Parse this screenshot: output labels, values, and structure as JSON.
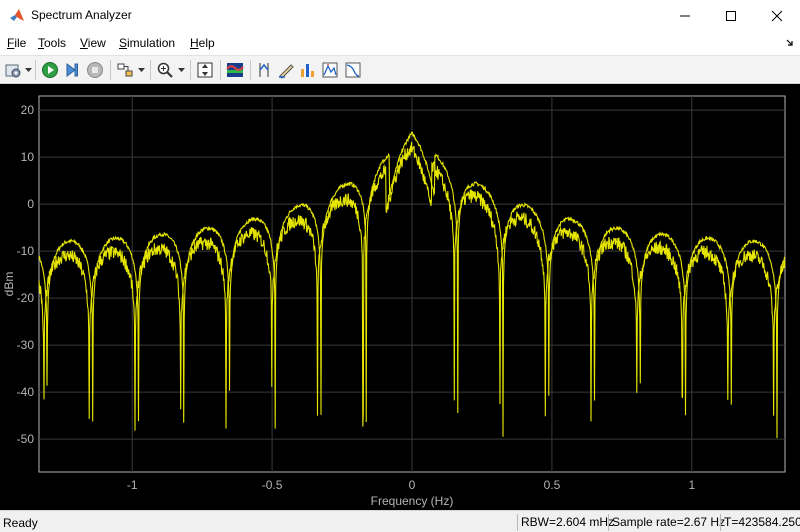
{
  "window": {
    "title": "Spectrum Analyzer",
    "app_icon": "matlab-logo-icon",
    "controls": [
      "minimize-icon",
      "maximize-icon",
      "close-icon"
    ]
  },
  "menu": {
    "items": [
      {
        "label": "File",
        "mnemonic": "F",
        "rest": "ile"
      },
      {
        "label": "Tools",
        "mnemonic": "T",
        "rest": "ools"
      },
      {
        "label": "View",
        "mnemonic": "V",
        "rest": "iew"
      },
      {
        "label": "Simulation",
        "mnemonic": "S",
        "rest": "imulation"
      },
      {
        "label": "Help",
        "mnemonic": "H",
        "rest": "elp"
      }
    ]
  },
  "toolbar": {
    "buttons": [
      "settings-icon",
      "run-icon",
      "step-forward-icon",
      "stop-icon",
      "highlight-block-icon",
      "zoom-in-icon",
      "scale-axes-icon",
      "spectrogram-icon",
      "cursor-measurements-icon",
      "channel-measurements-icon",
      "distortion-measurements-icon",
      "peak-finder-icon",
      "ccdf-measurements-icon"
    ]
  },
  "plot": {
    "background": "#000000",
    "axes_color": "#b4b4b4",
    "trace_color": "#e6e600"
  },
  "chart_data": {
    "type": "line",
    "xlabel": "Frequency (Hz)",
    "ylabel": "dBm",
    "xlim": [
      -1.333,
      1.333
    ],
    "ylim": [
      -57,
      23
    ],
    "xticks": [
      -1,
      -0.5,
      0,
      0.5,
      1
    ],
    "xtick_labels": [
      "-1",
      "-0.5",
      "0",
      "0.5",
      "1"
    ],
    "yticks": [
      20,
      10,
      0,
      -10,
      -20,
      -30,
      -40,
      -50
    ],
    "ytick_labels": [
      "20",
      "10",
      "0",
      "-10",
      "-20",
      "-30",
      "-40",
      "-50"
    ],
    "grid": true,
    "model": {
      "shape": "sinc-squared",
      "lobe_period_hz": 0.163,
      "main_lobe_peak_dbm": 15,
      "envelope_floor_dbm": -9,
      "envelope_decay_hz": 0.4,
      "null_depth_dbm": [
        -38,
        -50
      ],
      "offset_trace_db": -3
    },
    "series": [
      {
        "color": "#e6e600"
      },
      {
        "color": "#e6e600"
      }
    ]
  },
  "status": {
    "ready": "Ready",
    "rbw": "RBW=2.604 mHz",
    "sample_rate": "Sample rate=2.67 Hz",
    "time": "T=423584.250"
  }
}
